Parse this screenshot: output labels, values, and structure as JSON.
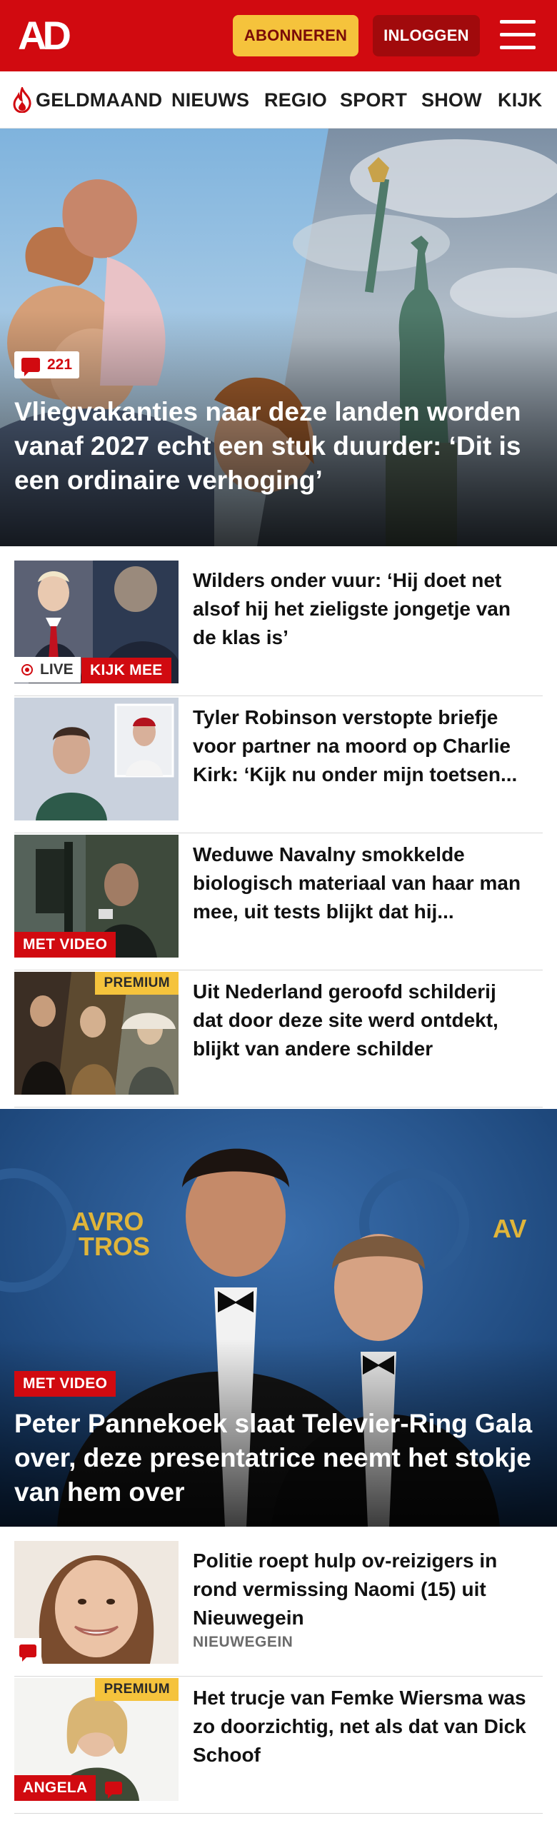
{
  "header": {
    "logo_text": "AD",
    "subscribe_label": "ABONNEREN",
    "login_label": "INLOGGEN",
    "brand_color": "#d10a10"
  },
  "nav": {
    "items": [
      {
        "label": "GELDMAAND",
        "icon": "flame-icon"
      },
      {
        "label": "NIEUWS"
      },
      {
        "label": "REGIO"
      },
      {
        "label": "SPORT"
      },
      {
        "label": "SHOW"
      },
      {
        "label": "KIJK"
      }
    ]
  },
  "hero": {
    "comment_count": "221",
    "title": "Vliegvakanties naar deze landen worden vanaf 2027 echt een stuk duurder: ‘Dit is een ordinaire verhoging’"
  },
  "articles": [
    {
      "title": "Wilders onder vuur: ‘Hij doet net alsof hij het zieligste jongetje van de klas is’",
      "live_label": "LIVE",
      "badge": "KIJK MEE"
    },
    {
      "title": "Tyler Robinson verstopte briefje voor partner na moord op Charlie Kirk: ‘Kijk nu onder mijn toetsen..."
    },
    {
      "title": "Weduwe Navalny smokkelde biologisch materiaal van haar man mee, uit tests blijkt dat hij...",
      "badge": "MET VIDEO"
    },
    {
      "title": "Uit Nederland geroofd schilderij dat door deze site werd ontdekt, blijkt van andere schilder",
      "premium": "PREMIUM"
    }
  ],
  "feature": {
    "badge": "MET VIDEO",
    "title": "Peter Pannekoek slaat Televier-Ring Gala over, deze presentatrice neemt het stokje van hem over"
  },
  "articles2": [
    {
      "title": "Politie roept hulp ov-reizigers in rond vermissing Naomi (15) uit Nieuwegein",
      "region": "NIEUWEGEIN"
    },
    {
      "title": "Het trucje van Femke Wiersma was zo doorzichtig, net als dat van Dick Schoof",
      "premium": "PREMIUM",
      "author_badge": "ANGELA"
    }
  ]
}
